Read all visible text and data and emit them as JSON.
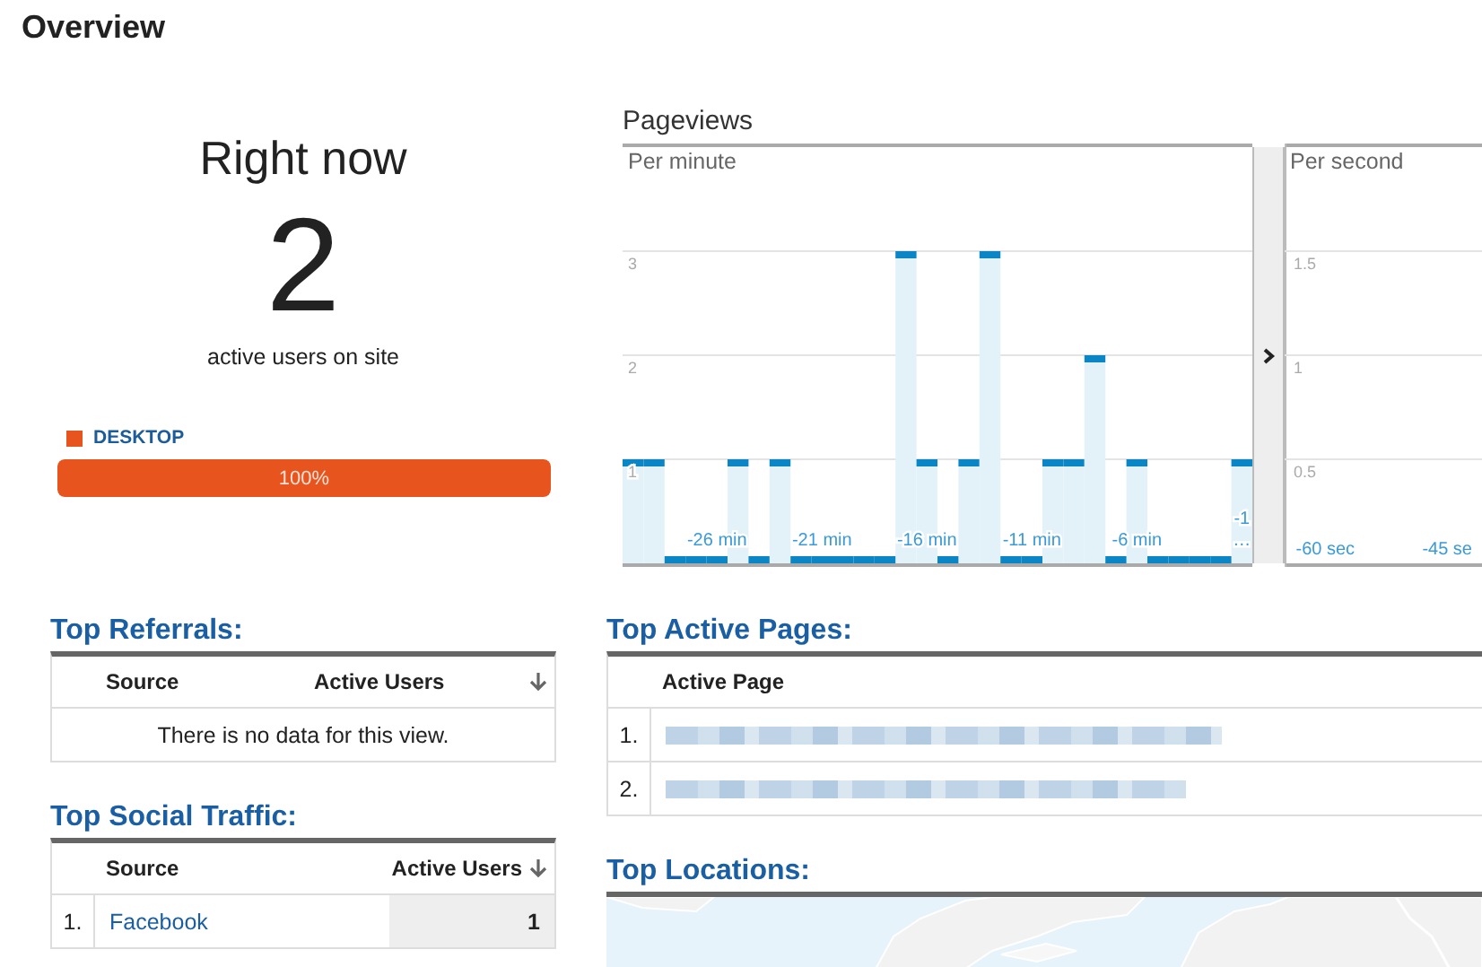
{
  "page": {
    "title": "Overview"
  },
  "right_now": {
    "title": "Right now",
    "count": "2",
    "caption": "active users on site",
    "devices": [
      {
        "label": "DESKTOP",
        "color": "#e8541e",
        "level": 1,
        "reading": "100%"
      }
    ]
  },
  "pageviews": {
    "title": "Pageviews",
    "per_minute": {
      "label": "Per minute",
      "chart_data": {
        "type": "bar",
        "grid": true,
        "categories": [
          null,
          null,
          null,
          null,
          "-26 min",
          null,
          null,
          null,
          null,
          "-21 min",
          null,
          null,
          null,
          null,
          "-16 min",
          null,
          null,
          null,
          null,
          "-11 min",
          null,
          null,
          null,
          null,
          "-6 min",
          null,
          null,
          null,
          null,
          "-1 …"
        ],
        "values": [
          1,
          1,
          0,
          0,
          0,
          1,
          0,
          1,
          0,
          0,
          0,
          0,
          0,
          3,
          1,
          0,
          1,
          3,
          0,
          0,
          1,
          1,
          2,
          0,
          1,
          0,
          0,
          0,
          0,
          1
        ],
        "ylim": [
          0,
          4
        ],
        "yticks": [
          1,
          2,
          3
        ]
      }
    },
    "per_second": {
      "label": "Per second",
      "chart_data": {
        "type": "bar",
        "grid": true,
        "xlim": [
          -65,
          -40.5
        ],
        "ylim": [
          0,
          2
        ],
        "yticks": [
          0.5,
          1,
          1.5
        ],
        "xticks": [
          {
            "value": -60,
            "label": "-60 sec"
          },
          {
            "value": -45,
            "label": "-45 se"
          }
        ]
      }
    }
  },
  "top_referrals": {
    "title": "Top Referrals:",
    "columns": [
      "Source",
      "Active Users"
    ],
    "empty_message": "There is no data for this view."
  },
  "top_social_traffic": {
    "title": "Top Social Traffic:",
    "columns": [
      "Source",
      "Active Users"
    ],
    "rows": [
      {
        "rank": "1.",
        "source": "Facebook",
        "active_users": "1"
      }
    ]
  },
  "top_active_pages": {
    "title": "Top Active Pages:",
    "columns": [
      "Active Page"
    ],
    "rows": [
      {
        "rank": "1."
      },
      {
        "rank": "2."
      }
    ]
  },
  "top_locations": {
    "title": "Top Locations:"
  }
}
